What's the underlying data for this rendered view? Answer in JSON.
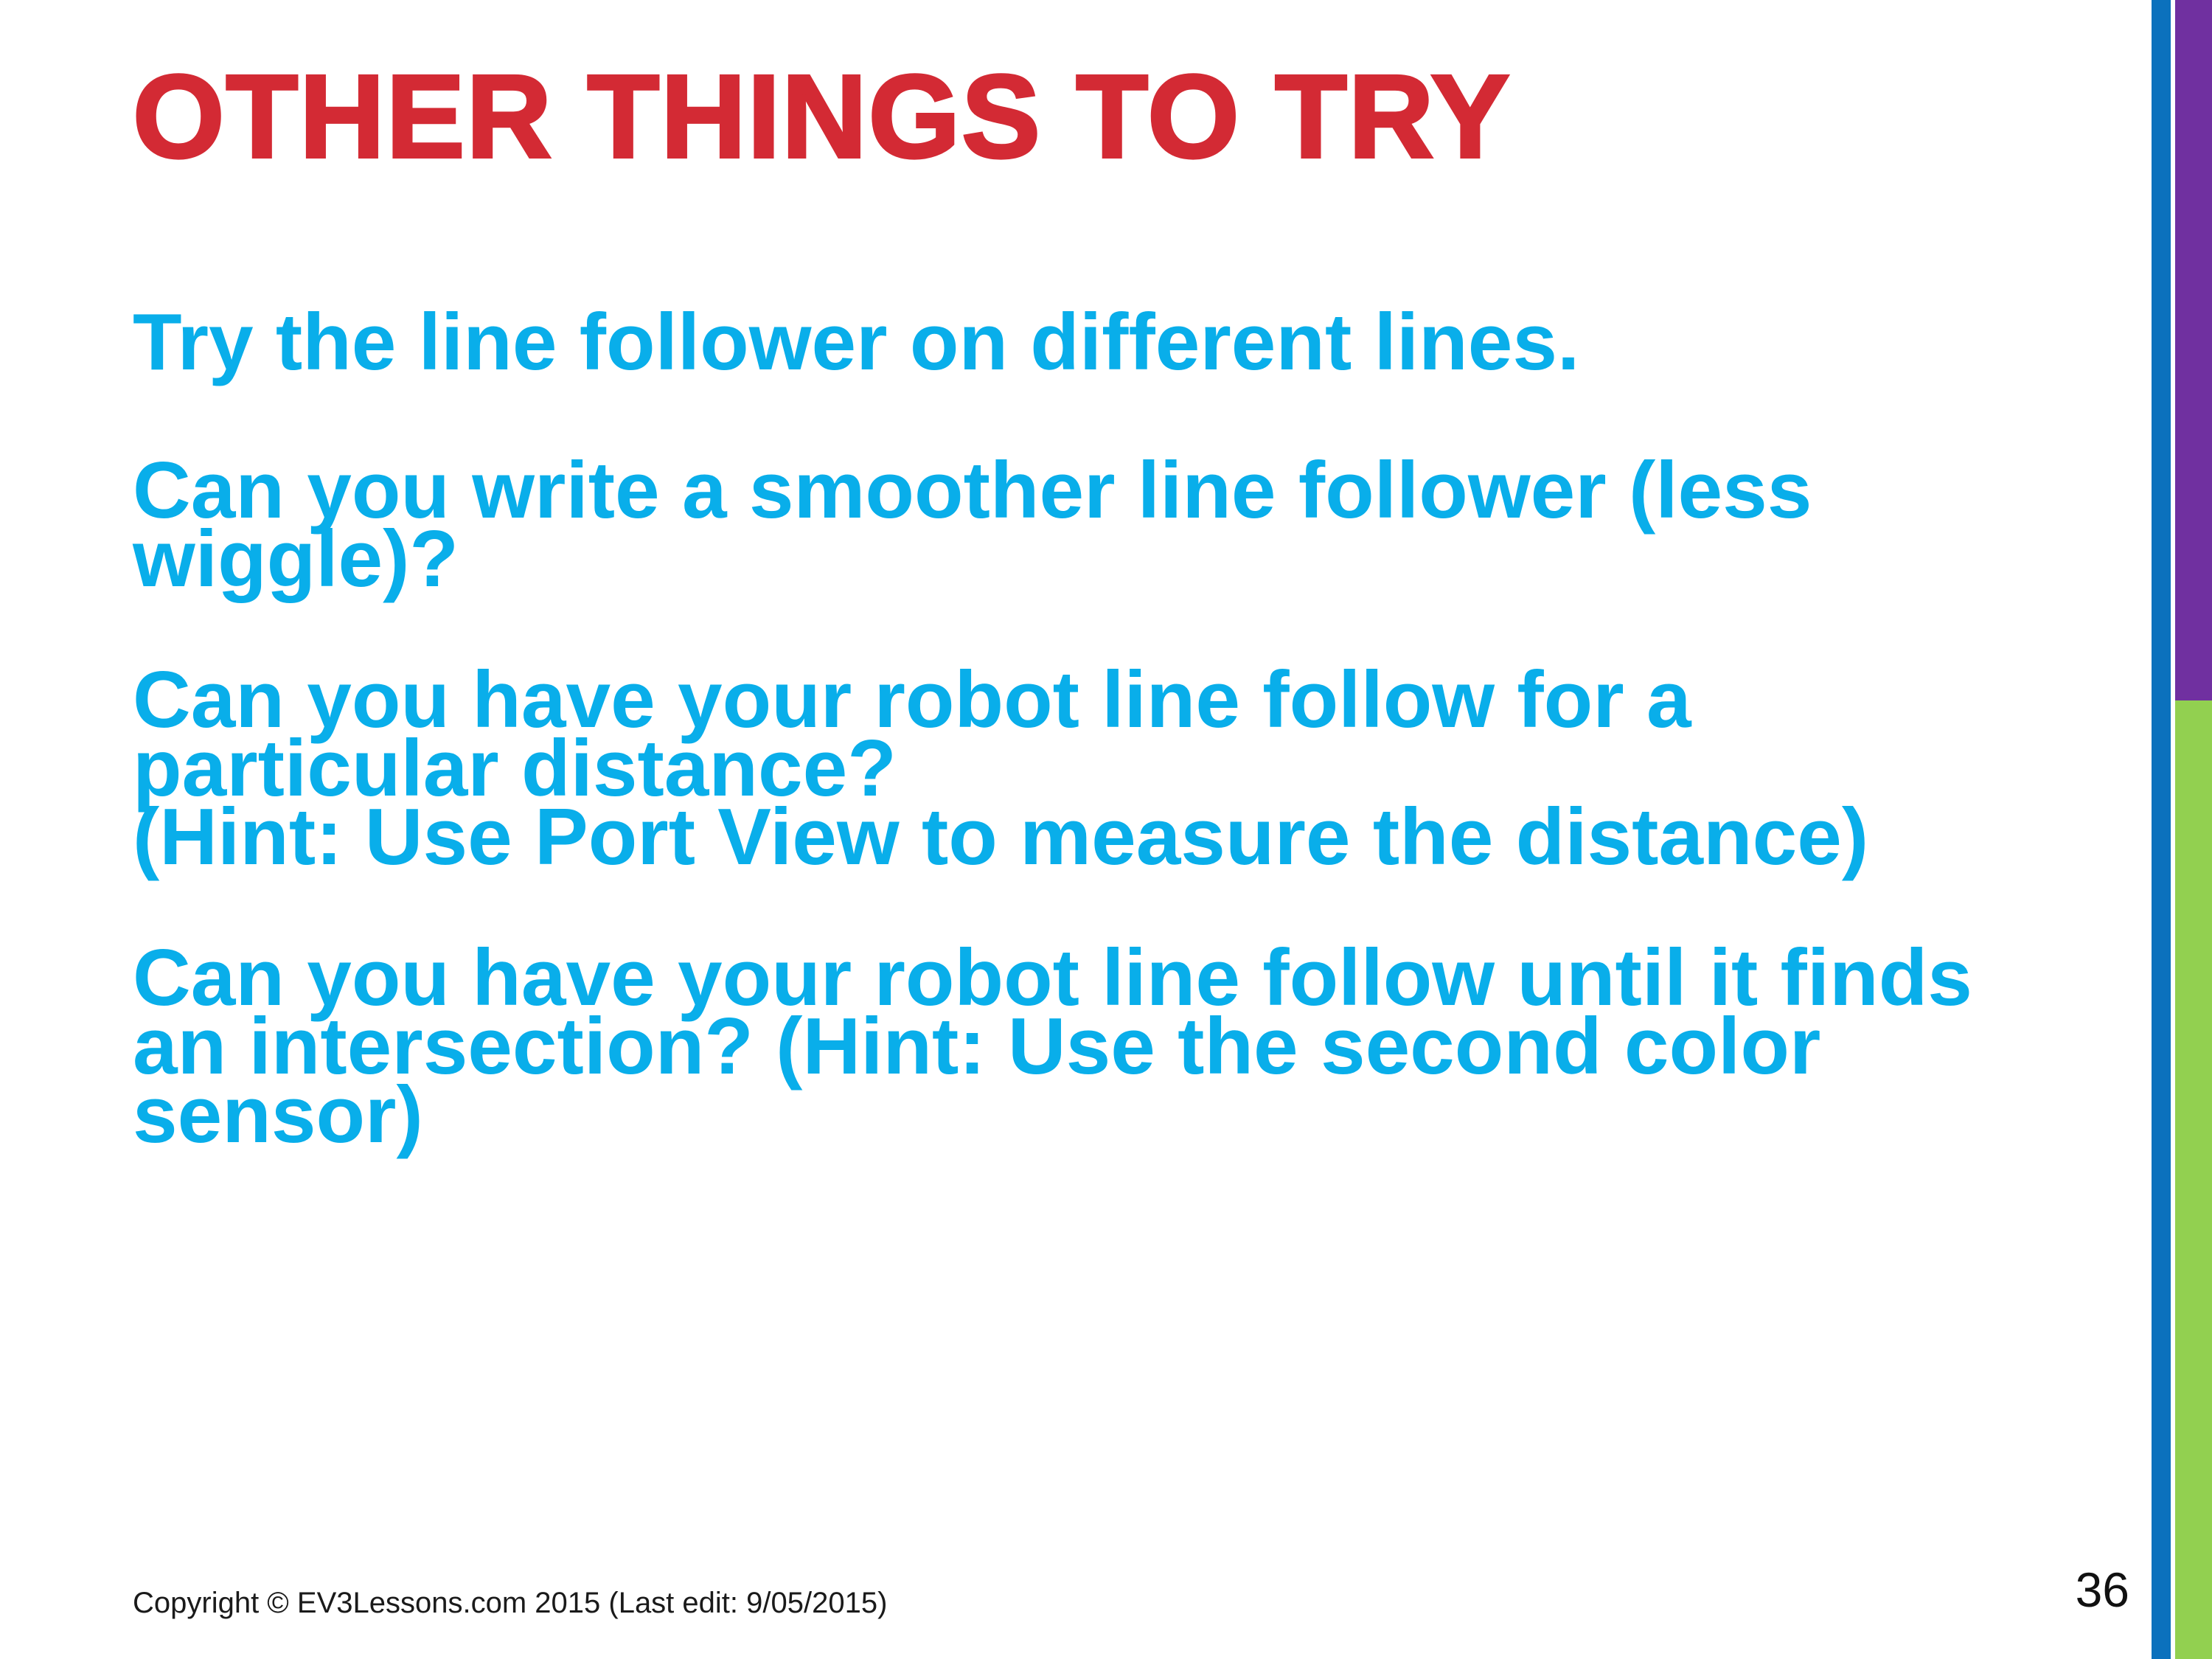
{
  "slide": {
    "title": "OTHER THINGS TO TRY",
    "bullets": [
      "Try the line follower on different lines.",
      "Can you write a smoother line follower (less wiggle)?",
      "Can you have your robot line follow for a particular distance?",
      "(Hint: Use Port View to measure the distance)",
      "Can you have your robot line follow until it finds an intersection? (Hint: Use the second color sensor)"
    ],
    "footer": "Copyright © EV3Lessons.com 2015 (Last edit: 9/05/2015)",
    "page_number": "36"
  },
  "colors": {
    "title": "#d32a34",
    "body_text": "#09aeea",
    "bar_blue": "#0b71bd",
    "bar_purple": "#7030a0",
    "bar_green": "#92d050"
  }
}
